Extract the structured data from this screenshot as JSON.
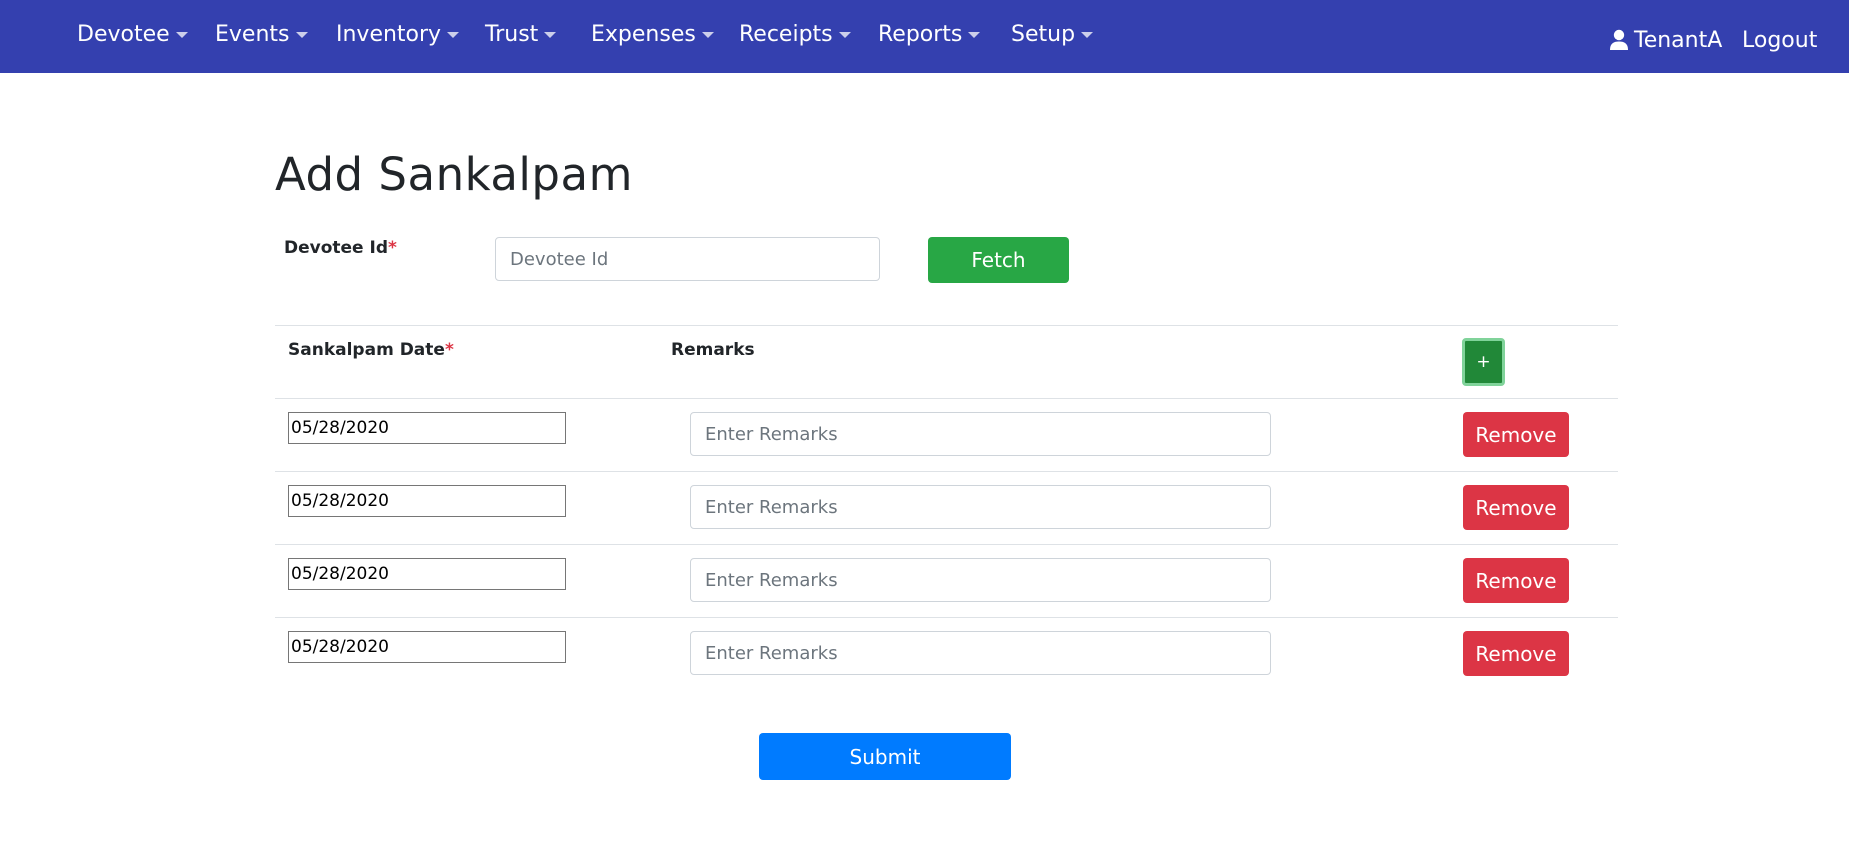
{
  "nav": {
    "menus": [
      {
        "label": "Devotee"
      },
      {
        "label": "Events"
      },
      {
        "label": "Inventory"
      },
      {
        "label": "Trust"
      },
      {
        "label": "Expenses"
      },
      {
        "label": "Receipts"
      },
      {
        "label": "Reports"
      },
      {
        "label": "Setup"
      }
    ],
    "user": "TenantA",
    "logout": "Logout",
    "user_icon": "user-icon",
    "bg_color": "#3440af"
  },
  "page": {
    "title": "Add Sankalpam"
  },
  "devotee": {
    "label": "Devotee Id",
    "required_mark": "*",
    "placeholder": "Devotee Id",
    "value": "",
    "fetch_label": "Fetch"
  },
  "table": {
    "col_date": "Sankalpam Date",
    "col_date_required": "*",
    "col_remarks": "Remarks",
    "add_label": "+",
    "rows": [
      {
        "date": "05/28/2020",
        "remarks_placeholder": "Enter Remarks",
        "remarks": "",
        "remove_label": "Remove"
      },
      {
        "date": "05/28/2020",
        "remarks_placeholder": "Enter Remarks",
        "remarks": "",
        "remove_label": "Remove"
      },
      {
        "date": "05/28/2020",
        "remarks_placeholder": "Enter Remarks",
        "remarks": "",
        "remove_label": "Remove"
      },
      {
        "date": "05/28/2020",
        "remarks_placeholder": "Enter Remarks",
        "remarks": "",
        "remove_label": "Remove"
      }
    ]
  },
  "form": {
    "submit_label": "Submit"
  },
  "colors": {
    "success": "#28a745",
    "danger": "#dc3545",
    "primary": "#007bff"
  }
}
